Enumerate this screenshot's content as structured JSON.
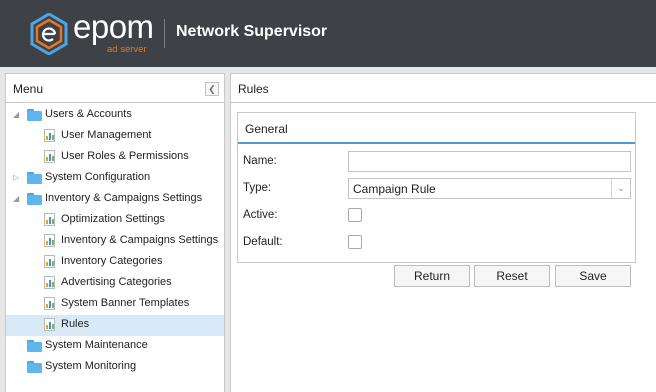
{
  "header": {
    "logo_text": "epom",
    "logo_subtext": "ad server",
    "app_title": "Network Supervisor"
  },
  "menu": {
    "title": "Menu",
    "collapse_icon": "chevron-left-icon",
    "items": [
      {
        "label": "Users & Accounts",
        "type": "folder",
        "level": 0,
        "expander": "expanded"
      },
      {
        "label": "User Management",
        "type": "leaf",
        "level": 1
      },
      {
        "label": "User Roles & Permissions",
        "type": "leaf",
        "level": 1
      },
      {
        "label": "System Configuration",
        "type": "folder",
        "level": 0,
        "expander": "collapsed"
      },
      {
        "label": "Inventory & Campaigns Settings",
        "type": "folder",
        "level": 0,
        "expander": "expanded"
      },
      {
        "label": "Optimization Settings",
        "type": "leaf",
        "level": 1
      },
      {
        "label": "Inventory & Campaigns Settings",
        "type": "leaf",
        "level": 1
      },
      {
        "label": "Inventory Categories",
        "type": "leaf",
        "level": 1
      },
      {
        "label": "Advertising Categories",
        "type": "leaf",
        "level": 1
      },
      {
        "label": "System Banner Templates",
        "type": "leaf",
        "level": 1
      },
      {
        "label": "Rules",
        "type": "leaf",
        "level": 1,
        "selected": true
      },
      {
        "label": "System Maintenance",
        "type": "folder",
        "level": 0,
        "expander": "none"
      },
      {
        "label": "System Monitoring",
        "type": "folder",
        "level": 0,
        "expander": "none"
      }
    ]
  },
  "rules": {
    "title": "Rules",
    "general": {
      "title": "General",
      "name_label": "Name:",
      "name_value": "",
      "type_label": "Type:",
      "type_value": "Campaign Rule",
      "active_label": "Active:",
      "active_checked": false,
      "default_label": "Default:",
      "default_checked": false
    },
    "buttons": {
      "return": "Return",
      "reset": "Reset",
      "save": "Save"
    }
  },
  "colors": {
    "header_bg": "#3e4247",
    "accent_blue": "#4e9bd8",
    "logo_orange": "#e8761e",
    "selected_row": "#d8eaf8",
    "folder_blue": "#5fb6ef"
  }
}
